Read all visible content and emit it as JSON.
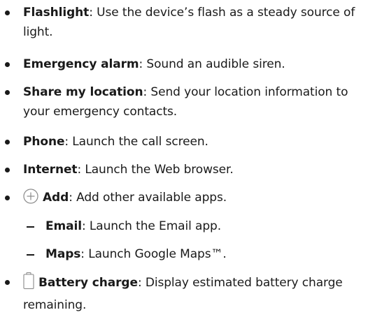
{
  "items": [
    {
      "term": "Flashlight",
      "description": ": Use the device’s flash as a steady source of light."
    },
    {
      "term": "Emergency alarm",
      "description": ": Sound an audible siren."
    },
    {
      "term": "Share my location",
      "description": ": Send your location information to your emergency contacts."
    },
    {
      "term": "Phone",
      "description": ": Launch the call screen."
    },
    {
      "term": "Internet",
      "description": ": Launch the Web browser."
    },
    {
      "term": "Add",
      "description": ": Add other available apps.",
      "icon": "plus-circle-icon"
    },
    {
      "term": "Email",
      "description": ": Launch the Email app."
    },
    {
      "term": "Maps",
      "description": ": Launch Google Maps™."
    },
    {
      "term": "Battery charge",
      "description": ": Display estimated battery charge remaining.",
      "icon": "battery-icon"
    }
  ]
}
